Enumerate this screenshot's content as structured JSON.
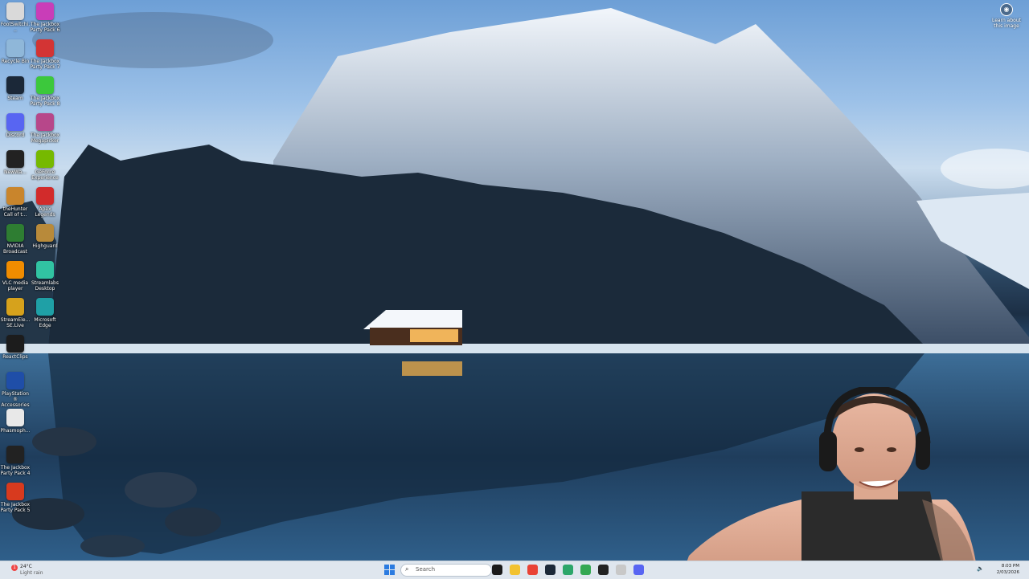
{
  "desktop": {
    "icons": [
      {
        "label": "FootSwitchi...",
        "icon": "footswitch-icon",
        "color": "#d9d9d9"
      },
      {
        "label": "The Jackbox Party Pack 6",
        "icon": "jackbox6-icon",
        "color": "#c93db8"
      },
      {
        "label": "Recycle Bin",
        "icon": "recycle-bin-icon",
        "color": "#8fb7d9"
      },
      {
        "label": "The Jackbox Party Pack 7",
        "icon": "jackbox7-icon",
        "color": "#d33434"
      },
      {
        "label": "Steam",
        "icon": "steam-icon",
        "color": "#1b2838"
      },
      {
        "label": "The Jackbox Party Pack 8",
        "icon": "jackbox8-icon",
        "color": "#3cc83c"
      },
      {
        "label": "Discord",
        "icon": "discord-icon",
        "color": "#5865f2"
      },
      {
        "label": "The Jackbox Megapicker",
        "icon": "jackbox-megapicker-icon",
        "color": "#b7478a"
      },
      {
        "label": "NewWa...",
        "icon": "app-icon",
        "color": "#222222"
      },
      {
        "label": "GeForce Experience",
        "icon": "geforce-icon",
        "color": "#76b900"
      },
      {
        "label": "theHunter Call of t...",
        "icon": "thehunter-icon",
        "color": "#c9852c"
      },
      {
        "label": "Apex Legends",
        "icon": "apex-icon",
        "color": "#d22b2b"
      },
      {
        "label": "NVIDIA Broadcast",
        "icon": "nvidia-broadcast-icon",
        "color": "#2e7d32"
      },
      {
        "label": "Highguard",
        "icon": "highguard-icon",
        "color": "#b88a3a"
      },
      {
        "label": "VLC media player",
        "icon": "vlc-icon",
        "color": "#f08c00"
      },
      {
        "label": "Streamlabs Desktop",
        "icon": "streamlabs-icon",
        "color": "#31c3a2"
      },
      {
        "label": "StreamEle... SE.Live",
        "icon": "streamelements-icon",
        "color": "#d6a21c"
      },
      {
        "label": "Microsoft Edge",
        "icon": "edge-icon",
        "color": "#1fa0a6"
      },
      {
        "label": "ReactClips",
        "icon": "reactclips-icon",
        "color": "#1c1c1c"
      },
      {
        "label": "PlayStation® Accessories",
        "icon": "playstation-icon",
        "color": "#1f4ea8"
      },
      {
        "label": "Phasmoph...",
        "icon": "phasmophobia-icon",
        "color": "#e8e8e8"
      },
      {
        "label": "The Jackbox Party Pack 4",
        "icon": "jackbox4-icon",
        "color": "#222222"
      },
      {
        "label": "The Jackbox Party Pack 5",
        "icon": "jackbox5-icon",
        "color": "#d83a1e"
      }
    ],
    "learn_about": "Learn about this image"
  },
  "taskbar": {
    "weather": {
      "temp": "24°C",
      "condition": "Light rain",
      "badge": "1"
    },
    "search_placeholder": "Search",
    "pinned": [
      {
        "icon": "explorer-icon",
        "color": "#1a1a1a"
      },
      {
        "icon": "file-explorer-icon",
        "color": "#f2c230"
      },
      {
        "icon": "chrome-icon",
        "color": "#e94235"
      },
      {
        "icon": "steam-icon",
        "color": "#1b2838"
      },
      {
        "icon": "app-icon",
        "color": "#2ca66a"
      },
      {
        "icon": "chrome-icon",
        "color": "#34a853"
      },
      {
        "icon": "obs-icon",
        "color": "#222222"
      },
      {
        "icon": "notes-icon",
        "color": "#c8c8c8"
      },
      {
        "icon": "discord-icon",
        "color": "#5865f2"
      }
    ],
    "clock_time": "8:03 PM",
    "clock_date": "2/03/2026"
  }
}
